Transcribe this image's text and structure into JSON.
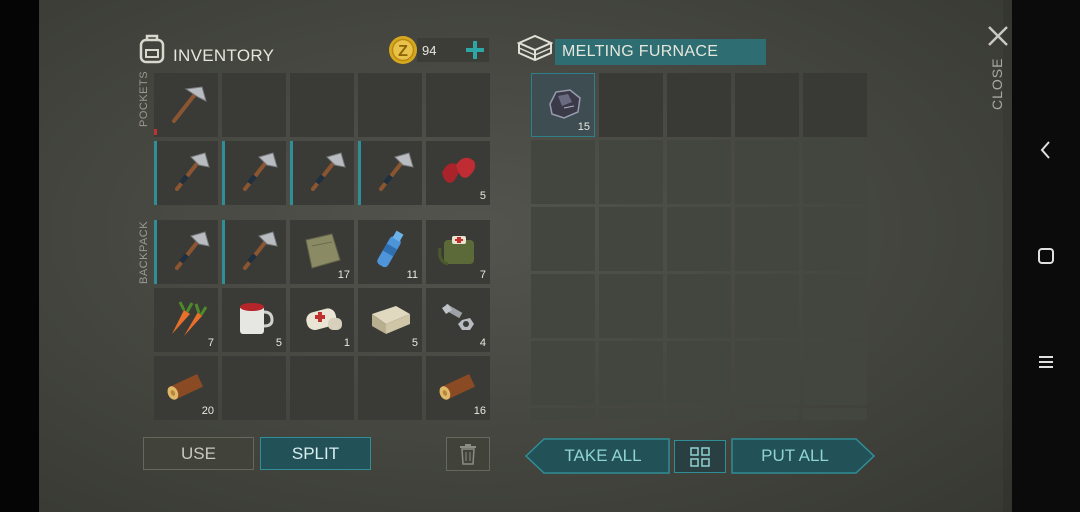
{
  "inventory": {
    "title": "INVENTORY",
    "coins": "94",
    "pockets_label": "POCKETS",
    "backpack_label": "BACKPACK",
    "quantities": {
      "r2c5": "5",
      "r3c3": "17",
      "r3c4": "11",
      "r3c5": "7",
      "r4c1": "7",
      "r4c2": "5",
      "r4c3": "1",
      "r4c4": "5",
      "r4c5": "4",
      "r5c1": "20",
      "r5c5": "16"
    }
  },
  "container": {
    "title": "MELTING FURNACE",
    "item_qty": "15"
  },
  "buttons": {
    "use": "USE",
    "split": "SPLIT",
    "take_all": "TAKE ALL",
    "put_all": "PUT ALL",
    "close": "CLOSE"
  },
  "colors": {
    "teal": "#2f8e96",
    "panel_bg": "#46473f",
    "text": "#e6e6dc"
  },
  "icons": {
    "backpack": "backpack-icon",
    "coin": "coin-icon",
    "plus": "plus-icon",
    "furnace": "furnace-icon",
    "trash": "trash-icon",
    "grid": "grid-icon",
    "close": "close-icon",
    "back": "back-chevron-icon",
    "home": "home-icon",
    "menu": "menu-icon"
  }
}
